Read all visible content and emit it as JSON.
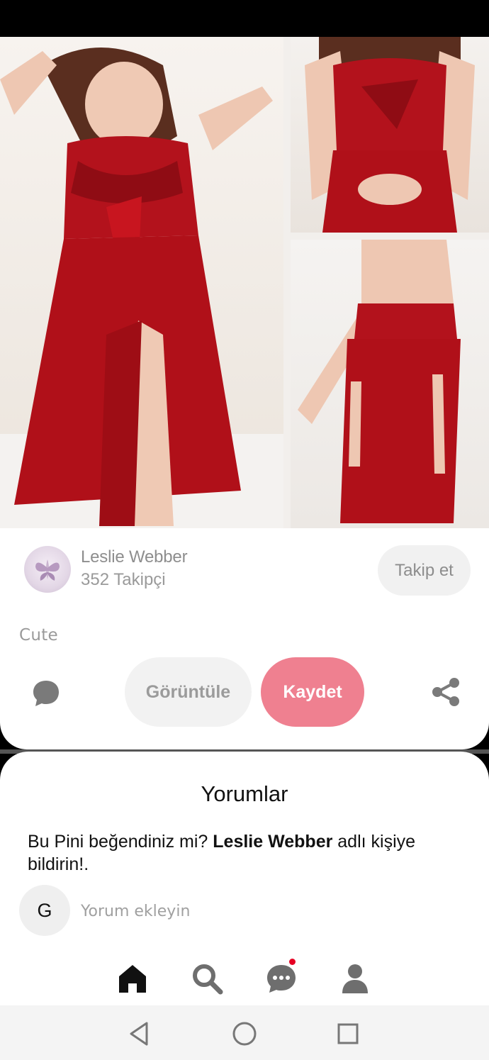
{
  "pin": {
    "image_description_icon": "lingerie-collage-image"
  },
  "creator": {
    "name": "Leslie Webber",
    "followers": "352 Takipçi",
    "follow_label": "Takip et"
  },
  "pin_description": "Cute",
  "actions": {
    "view_label": "Görüntüle",
    "save_label": "Kaydet",
    "comment_icon": "comment-icon",
    "share_icon": "share-icon"
  },
  "comments": {
    "title": "Yorumlar",
    "prompt_prefix": "Bu Pini beğendiniz mi?",
    "prompt_name": "Leslie Webber",
    "prompt_suffix": "adlı kişiye bildirin!.",
    "user_initial": "G",
    "placeholder": "Yorum ekleyin"
  },
  "bottom_nav": [
    "home-icon",
    "search-icon",
    "messages-icon",
    "profile-icon"
  ],
  "colors": {
    "save": "#ef8090",
    "notification": "#e60023",
    "dress": "#b3121c"
  }
}
